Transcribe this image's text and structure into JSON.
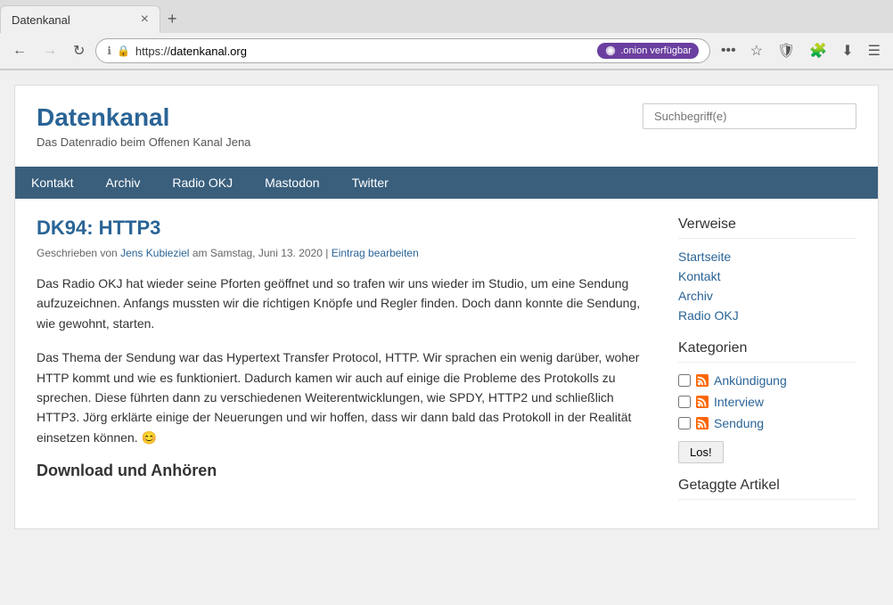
{
  "browser": {
    "tab_title": "Datenkanal",
    "tab_close": "×",
    "tab_add": "+",
    "url": "https://datenkanal.org",
    "url_display_prefix": "https://",
    "url_display_domain": "datenkanal.org",
    "info_icon": "ℹ",
    "lock_icon": "🔒",
    "onion_label": ".onion verfügbar",
    "more_btn": "•••",
    "bookmark_icon": "☆",
    "shield_icon": "🛡",
    "extension_icon": "🧩",
    "download_icon": "⬇",
    "menu_icon": "☰",
    "back_icon": "←",
    "forward_icon": "→",
    "refresh_icon": "↻"
  },
  "site": {
    "title": "Datenkanal",
    "tagline": "Das Datenradio beim Offenen Kanal Jena",
    "search_placeholder": "Suchbegriff(e)"
  },
  "nav": {
    "items": [
      {
        "label": "Kontakt",
        "id": "kontakt"
      },
      {
        "label": "Archiv",
        "id": "archiv"
      },
      {
        "label": "Radio OKJ",
        "id": "radio-okj"
      },
      {
        "label": "Mastodon",
        "id": "mastodon"
      },
      {
        "label": "Twitter",
        "id": "twitter"
      }
    ]
  },
  "post": {
    "title": "DK94: HTTP3",
    "meta_prefix": "Geschrieben von",
    "author": "Jens Kubieziel",
    "meta_date": "am Samstag, Juni 13. 2020 |",
    "edit_link": "Eintrag bearbeiten",
    "paragraphs": [
      "Das Radio OKJ hat wieder seine Pforten geöffnet und so trafen wir uns wieder im Studio, um eine Sendung aufzuzeichnen. Anfangs mussten wir die richtigen Knöpfe und Regler finden. Doch dann konnte die Sendung, wie gewohnt, starten.",
      "Das Thema der Sendung war das Hypertext Transfer Protocol, HTTP. Wir sprachen ein wenig darüber, woher HTTP kommt und wie es funktioniert. Dadurch kamen wir auch auf einige die Probleme des Protokolls zu sprechen. Diese führten dann zu verschiedenen Weiterentwicklungen, wie SPDY, HTTP2 und schließlich HTTP3. Jörg erklärte einige der Neuerungen und wir hoffen, dass wir dann bald das Protokoll in der Realität einsetzen können. 😊"
    ],
    "subtitle": "Download und Anhören"
  },
  "sidebar": {
    "verweise_title": "Verweise",
    "links": [
      {
        "label": "Startseite",
        "href": "#"
      },
      {
        "label": "Kontakt",
        "href": "#"
      },
      {
        "label": "Archiv",
        "href": "#"
      },
      {
        "label": "Radio OKJ",
        "href": "#"
      }
    ],
    "kategorien_title": "Kategorien",
    "categories": [
      {
        "label": "Ankündigung"
      },
      {
        "label": "Interview"
      },
      {
        "label": "Sendung"
      }
    ],
    "los_label": "Los!",
    "getaggte_title": "Getaggte Artikel"
  },
  "colors": {
    "accent": "#2a6496",
    "nav_bg": "#3a5f7d",
    "onion_bg": "#6b3fa0"
  }
}
